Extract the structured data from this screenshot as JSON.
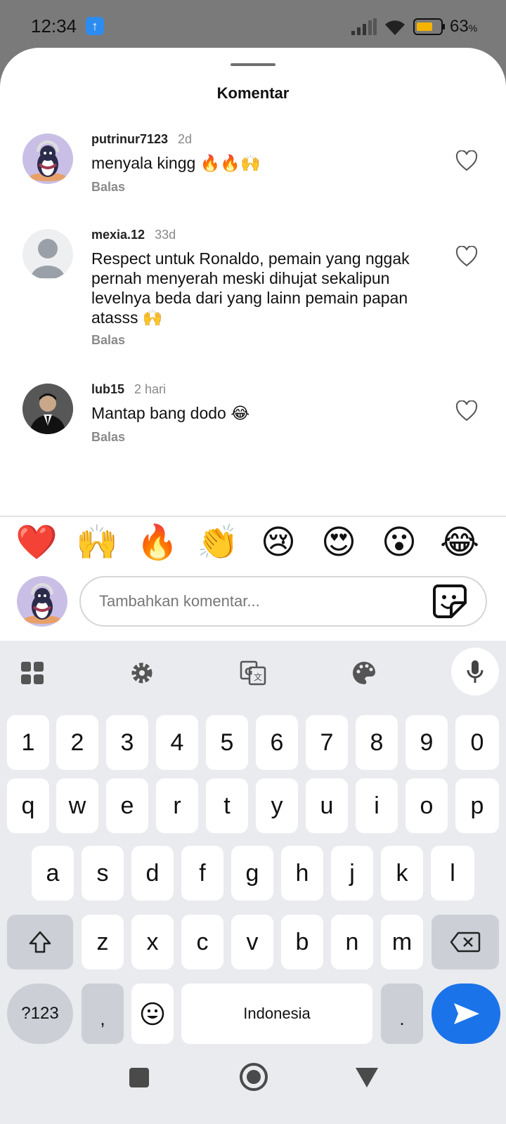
{
  "status_bar": {
    "time": "12:34",
    "battery_pct": "63",
    "battery_unit": "%"
  },
  "sheet": {
    "title": "Komentar"
  },
  "comments": [
    {
      "user": "putrinur7123",
      "time": "2d",
      "text": "menyala kingg 🔥🔥🙌",
      "reply": "Balas"
    },
    {
      "user": "mexia.12",
      "time": "33d",
      "text": "Respect untuk Ronaldo, pemain yang nggak pernah menyerah meski dihujat sekalipun levelnya beda dari yang lainn pemain papan atasss 🙌",
      "reply": "Balas"
    },
    {
      "user": "lub15",
      "time": "2 hari",
      "text": "Mantap bang dodo 😂",
      "reply": "Balas"
    }
  ],
  "quick_emojis": [
    "❤️",
    "🙌",
    "🔥",
    "👏",
    "😢",
    "😍",
    "😮",
    "😂"
  ],
  "composer": {
    "placeholder": "Tambahkan komentar..."
  },
  "keyboard": {
    "row_numbers": [
      "1",
      "2",
      "3",
      "4",
      "5",
      "6",
      "7",
      "8",
      "9",
      "0"
    ],
    "row_q": [
      "q",
      "w",
      "e",
      "r",
      "t",
      "y",
      "u",
      "i",
      "o",
      "p"
    ],
    "row_a": [
      "a",
      "s",
      "d",
      "f",
      "g",
      "h",
      "j",
      "k",
      "l"
    ],
    "row_z": [
      "z",
      "x",
      "c",
      "v",
      "b",
      "n",
      "m"
    ],
    "symbols_label": "?123",
    "comma": ",",
    "period": ".",
    "space_label": "Indonesia"
  },
  "colors": {
    "accent": "#1a73e8",
    "status_bar": "#7a7a7a",
    "upload_badge": "#2d8cf0"
  }
}
